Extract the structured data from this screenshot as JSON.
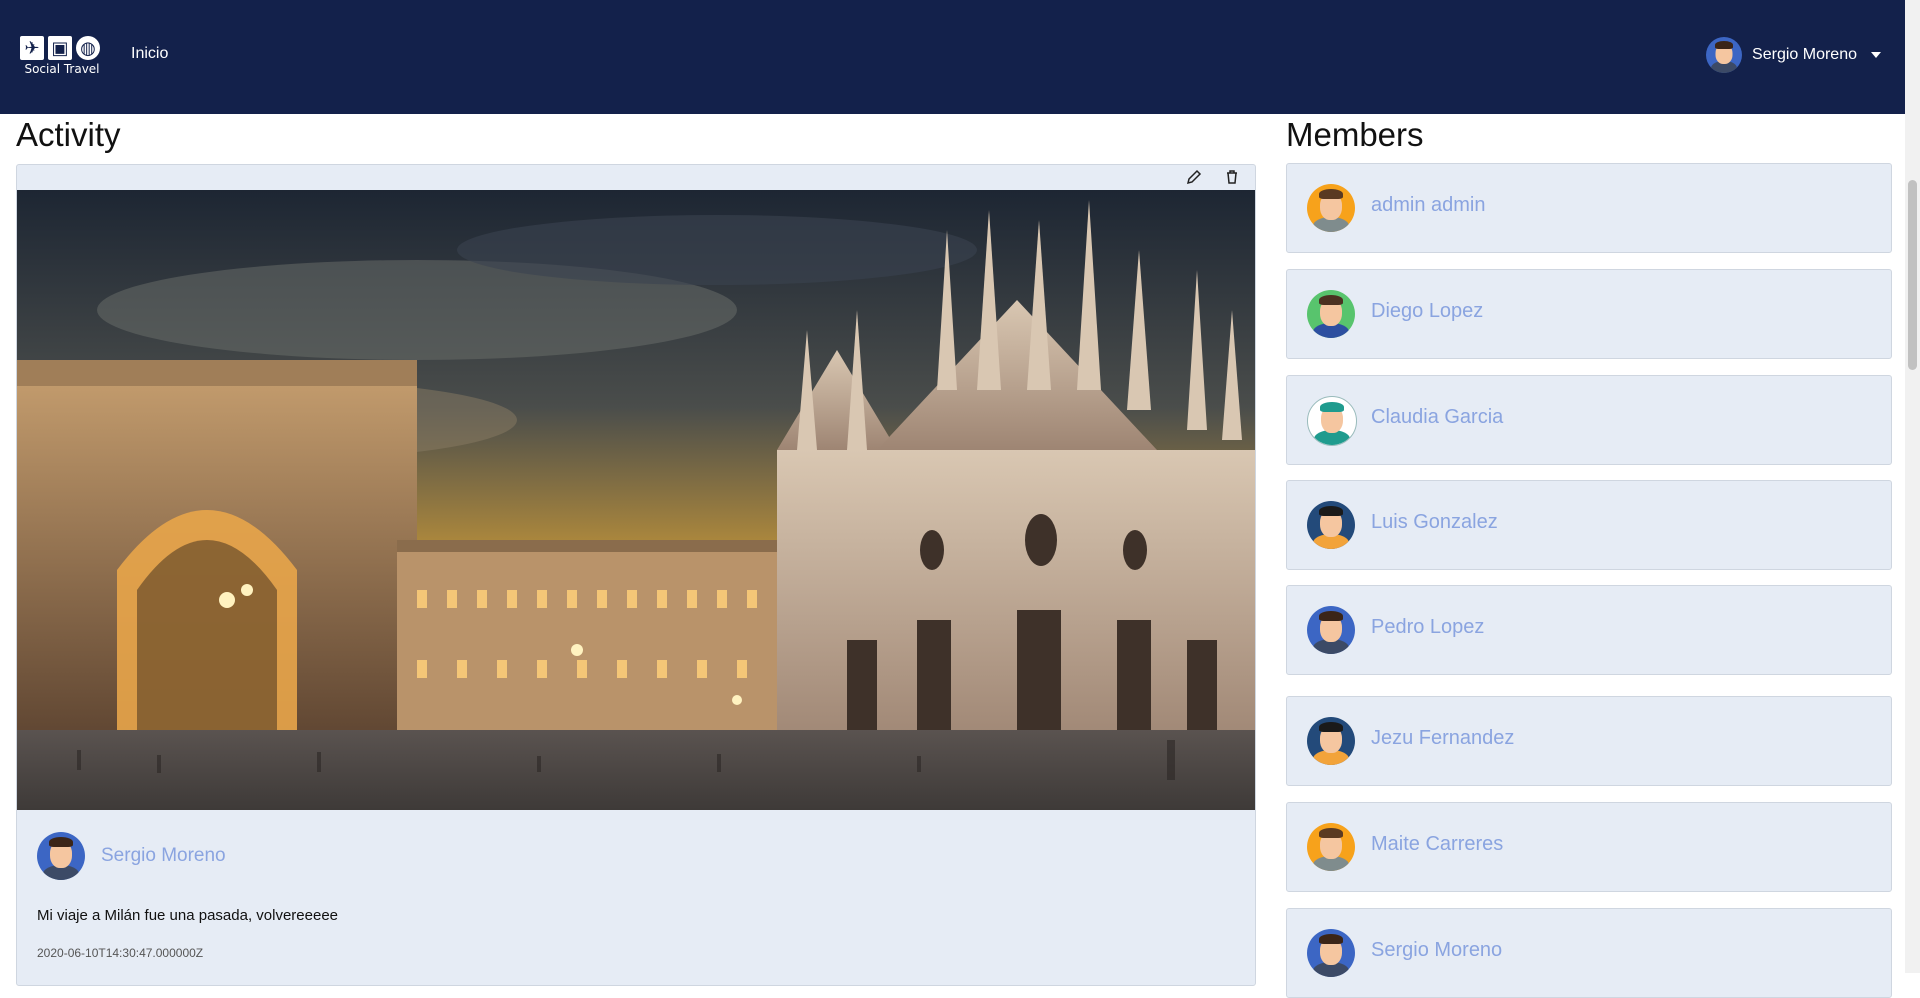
{
  "navbar": {
    "brand_text": "Social Travel",
    "brand_icons": [
      "airplane-icon",
      "luggage-icon",
      "globe-icon"
    ],
    "nav_link": "Inicio",
    "user_name": "Sergio Moreno"
  },
  "activity": {
    "section_title": "Activity",
    "toolbar": {
      "edit_icon": "pencil-icon",
      "delete_icon": "trash-icon"
    },
    "photo_description": "Milan Cathedral and Galleria",
    "author": "Sergio Moreno",
    "text": "Mi viaje a Milán fue una pasada, volvereeeee",
    "date": "2020-06-10T14:30:47.000000Z"
  },
  "members": {
    "section_title": "Members",
    "items": [
      {
        "name": "admin admin",
        "avatar_bg": "#f7a21b",
        "skin": "#f5c6a0",
        "hair": "#5a3a22",
        "shirt": "#7f8c8d"
      },
      {
        "name": "Diego Lopez",
        "avatar_bg": "#58c46d",
        "skin": "#f5c6a0",
        "hair": "#4b3121",
        "shirt": "#2d4fa0"
      },
      {
        "name": "Claudia Garcia",
        "avatar_bg": "#ffffff",
        "skin": "#f5c6a0",
        "hair": "#1f9b8e",
        "shirt": "#1f9b8e"
      },
      {
        "name": "Luis Gonzalez",
        "avatar_bg": "#234a7a",
        "skin": "#f5c6a0",
        "hair": "#1a1a1a",
        "shirt": "#f2a33a"
      },
      {
        "name": "Pedro Lopez",
        "avatar_bg": "#3c66c4",
        "skin": "#f5c6a0",
        "hair": "#3b2518",
        "shirt": "#3c4a66"
      },
      {
        "name": "Jezu Fernandez",
        "avatar_bg": "#234a7a",
        "skin": "#f5c6a0",
        "hair": "#1a1a1a",
        "shirt": "#f2a33a"
      },
      {
        "name": "Maite Carreres",
        "avatar_bg": "#f7a21b",
        "skin": "#f5c6a0",
        "hair": "#5a3a22",
        "shirt": "#7f8c8d"
      },
      {
        "name": "Sergio Moreno",
        "avatar_bg": "#3c66c4",
        "skin": "#f5c6a0",
        "hair": "#3b2518",
        "shirt": "#3c4a66"
      }
    ]
  }
}
